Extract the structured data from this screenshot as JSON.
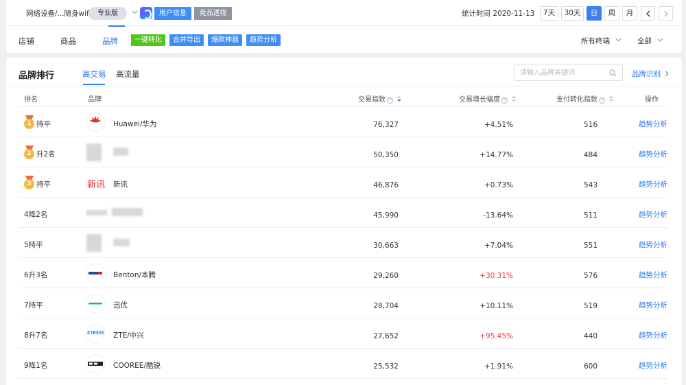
{
  "header": {
    "category": "网络设备/...随身wifi",
    "edition": "专业版",
    "user_info": "用户信息",
    "competitor_view": "竞品透视",
    "stat_time": "统计时间 2020-11-13",
    "periods": [
      "7天",
      "30天",
      "日",
      "周",
      "月"
    ],
    "active_period": "日",
    "tabs": [
      "店铺",
      "商品",
      "品牌"
    ],
    "active_tab": "品牌",
    "actions": [
      {
        "label": "一键转化",
        "color": "#52c41a"
      },
      {
        "label": "合并导出",
        "color": "#3d8ef6"
      },
      {
        "label": "爆款神器",
        "color": "#3d8ef6"
      },
      {
        "label": "趋势分析",
        "color": "#3d8ef6"
      }
    ],
    "filter_terminal": "所有终端",
    "filter_all": "全部"
  },
  "main": {
    "title": "品牌排行",
    "subtabs": [
      "高交易",
      "高流量"
    ],
    "active_subtab": "高交易",
    "search_placeholder": "请输入品牌关键词",
    "brand_recognition": "品牌识别"
  },
  "table": {
    "columns": [
      "排名",
      "品牌",
      "交易指数",
      "交易增长幅度",
      "支付转化指数",
      "操作"
    ],
    "sorted_column": "交易指数",
    "sort_direction": "desc",
    "rows": [
      {
        "rank": "1",
        "change": "持平",
        "brand": "Huawei/华为",
        "logo": "huawei",
        "trade": "76,327",
        "growth": "+4.51%",
        "growth_highlight": false,
        "conv": "516",
        "op": "趋势分析"
      },
      {
        "rank": "2",
        "change": "升2名",
        "brand": "",
        "logo": "blurred",
        "trade": "50,350",
        "growth": "+14.77%",
        "growth_highlight": false,
        "conv": "484",
        "op": "趋势分析"
      },
      {
        "rank": "3",
        "change": "持平",
        "brand": "新讯",
        "logo_text": "新讯",
        "logo": "xinxun",
        "trade": "46,876",
        "growth": "+0.73%",
        "growth_highlight": false,
        "conv": "543",
        "op": "趋势分析"
      },
      {
        "rank": "4",
        "change": "4降2名",
        "brand": "",
        "logo": "blurred",
        "trade": "45,990",
        "growth": "-13.64%",
        "growth_highlight": false,
        "conv": "511",
        "op": "趋势分析"
      },
      {
        "rank": "5",
        "change": "5持平",
        "brand": "",
        "logo": "blurred",
        "trade": "30,663",
        "growth": "+7.04%",
        "growth_highlight": false,
        "conv": "551",
        "op": "趋势分析"
      },
      {
        "rank": "6",
        "change": "6升3名",
        "brand": "Benton/本腾",
        "logo": "benton",
        "trade": "29,260",
        "growth": "+30.31%",
        "growth_highlight": true,
        "conv": "576",
        "op": "趋势分析"
      },
      {
        "rank": "7",
        "change": "7持平",
        "brand": "迅优",
        "logo": "xunyou",
        "trade": "28,704",
        "growth": "+10.11%",
        "growth_highlight": false,
        "conv": "519",
        "op": "趋势分析"
      },
      {
        "rank": "8",
        "change": "8升7名",
        "brand": "ZTE/中兴",
        "logo_text": "ZTE中兴",
        "logo": "zte",
        "trade": "27,652",
        "growth": "+95.45%",
        "growth_highlight": true,
        "conv": "440",
        "op": "趋势分析"
      },
      {
        "rank": "9",
        "change": "9降1名",
        "brand": "COOREE/酷锐",
        "logo": "cooree",
        "trade": "25,532",
        "growth": "+1.91%",
        "growth_highlight": false,
        "conv": "600",
        "op": "趋势分析"
      }
    ]
  },
  "colors": {
    "primary": "#2f7bf2",
    "growth_up": "#f0373c",
    "medal": "#f6b73c"
  }
}
